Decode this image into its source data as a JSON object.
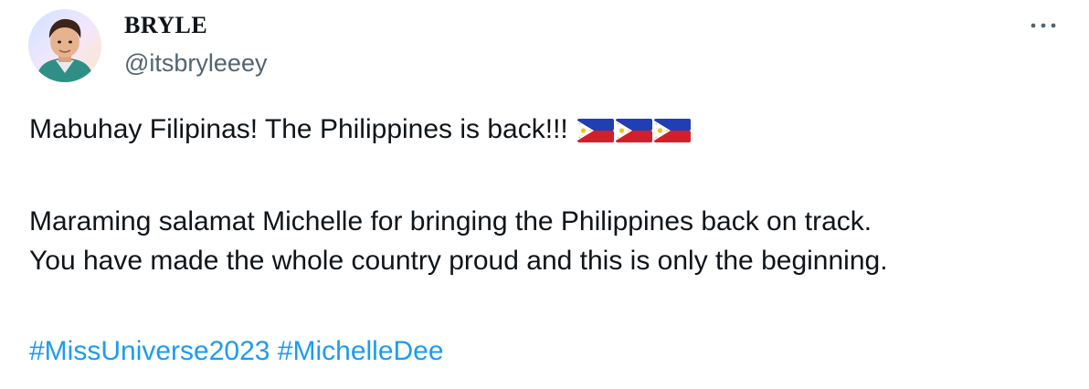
{
  "tweet": {
    "author": {
      "display_name": "BRYLE",
      "handle": "@itsbryleeey"
    },
    "lines": [
      "Mabuhay Filipinas! The Philippines is back!!!",
      "Maraming salamat Michelle for bringing the Philippines back on track.",
      "You have made the whole country proud and this is only the beginning."
    ],
    "flag_emoji": [
      "philippines-flag-emoji",
      "philippines-flag-emoji",
      "philippines-flag-emoji"
    ],
    "hashtags": [
      "#MissUniverse2023",
      "#MichelleDee"
    ],
    "icons": {
      "more": "more-horizontal-icon",
      "avatar": "profile-avatar"
    },
    "colors": {
      "text": "#0f1419",
      "secondary": "#536471",
      "link": "#1d9bf0",
      "flag_blue": "#1f3fb3",
      "flag_red": "#d1202a",
      "flag_sun": "#f2c318"
    }
  }
}
